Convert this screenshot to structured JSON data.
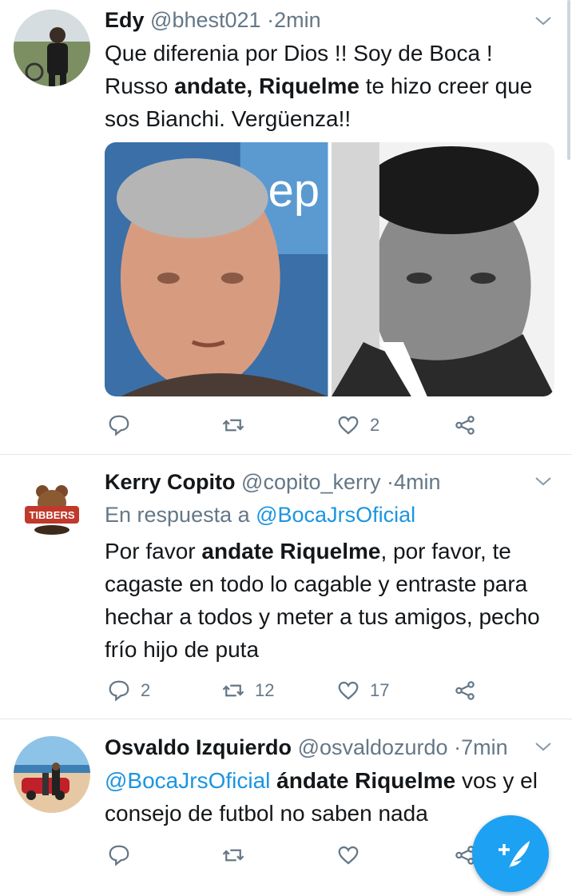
{
  "tweets": [
    {
      "name": "Edy",
      "handle": "@bhest021",
      "sep": "·",
      "time": "2min",
      "text_parts": [
        "Que diferenia por Dios !! Soy de Boca ! Russo ",
        "andate, Riquelme",
        " te hizo creer que sos Bianchi. Vergüenza!!"
      ],
      "media_alt": [
        "photo-left-man",
        "photo-right-man"
      ],
      "actions": {
        "reply": "",
        "retweet": "",
        "like": "2"
      }
    },
    {
      "name": "Kerry Copito",
      "handle": "@copito_kerry",
      "sep": "·",
      "time": "4min",
      "reply_prefix": "En respuesta a ",
      "reply_to": "@BocaJrsOficial",
      "text_parts": [
        "Por favor ",
        "andate Riquelme",
        ", por favor, te cagaste en todo lo cagable y entraste para hechar a todos y meter a tus amigos, pecho frío hijo de puta"
      ],
      "avatar_text": "TIBBERS",
      "actions": {
        "reply": "2",
        "retweet": "12",
        "like": "17"
      }
    },
    {
      "name": "Osvaldo Izquierdo",
      "handle": "@osvaldozurdo",
      "sep": "·",
      "time": "7min",
      "text_parts": [
        "@BocaJrsOficial",
        " ",
        "ándate Riquelme",
        " vos y el consejo de futbol no saben nada"
      ],
      "actions": {
        "reply": "",
        "retweet": "",
        "like": ""
      }
    }
  ],
  "colors": {
    "accent": "#1da1f2",
    "mention": "#1b95e0",
    "muted": "#657786"
  }
}
